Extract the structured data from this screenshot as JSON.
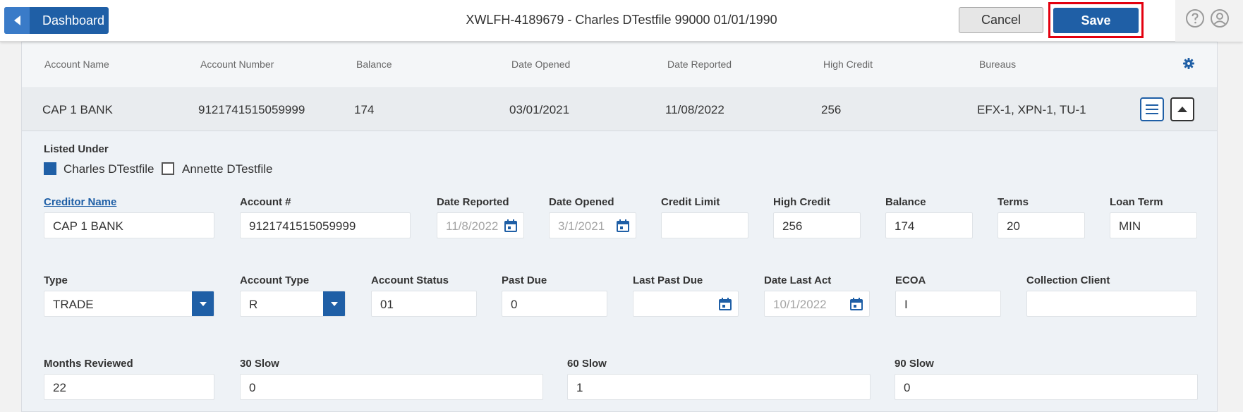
{
  "header": {
    "dashboard_label": "Dashboard",
    "title": "XWLFH-4189679 - Charles DTestfile 99000 01/01/1990",
    "cancel_label": "Cancel",
    "save_label": "Save"
  },
  "table": {
    "columns": [
      "Account Name",
      "Account Number",
      "Balance",
      "Date Opened",
      "Date Reported",
      "High Credit",
      "Bureaus"
    ],
    "row": [
      "CAP 1 BANK",
      "9121741515059999",
      "174",
      "03/01/2021",
      "11/08/2022",
      "256",
      "EFX-1, XPN-1, TU-1"
    ]
  },
  "detail": {
    "listed_under_label": "Listed Under",
    "listed_under": [
      {
        "name": "Charles DTestfile",
        "checked": true
      },
      {
        "name": "Annette DTestfile",
        "checked": false
      }
    ],
    "row1": [
      {
        "label": "Creditor Name",
        "value": "CAP 1 BANK"
      },
      {
        "label": "Account #",
        "value": "9121741515059999"
      },
      {
        "label": "Date Reported",
        "value": "11/8/2022"
      },
      {
        "label": "Date Opened",
        "value": "3/1/2021"
      },
      {
        "label": "Credit Limit",
        "value": ""
      },
      {
        "label": "High Credit",
        "value": "256"
      },
      {
        "label": "Balance",
        "value": "174"
      },
      {
        "label": "Terms",
        "value": "20"
      },
      {
        "label": "Loan Term",
        "value": "MIN"
      }
    ],
    "row2": [
      {
        "label": "Type",
        "value": "TRADE"
      },
      {
        "label": "Account Type",
        "value": "R"
      },
      {
        "label": "Account Status",
        "value": "01"
      },
      {
        "label": "Past Due",
        "value": "0"
      },
      {
        "label": "Last Past Due",
        "value": ""
      },
      {
        "label": "Date Last Act",
        "value": "10/1/2022"
      },
      {
        "label": "ECOA",
        "value": "I"
      },
      {
        "label": "Collection Client",
        "value": ""
      }
    ],
    "row3": [
      {
        "label": "Months Reviewed",
        "value": "22"
      },
      {
        "label": "30 Slow",
        "value": "0"
      },
      {
        "label": "60 Slow",
        "value": "1"
      },
      {
        "label": "90 Slow",
        "value": "0"
      }
    ]
  },
  "colors": {
    "primary": "#1f5fa6",
    "highlight": "#e3000f"
  }
}
